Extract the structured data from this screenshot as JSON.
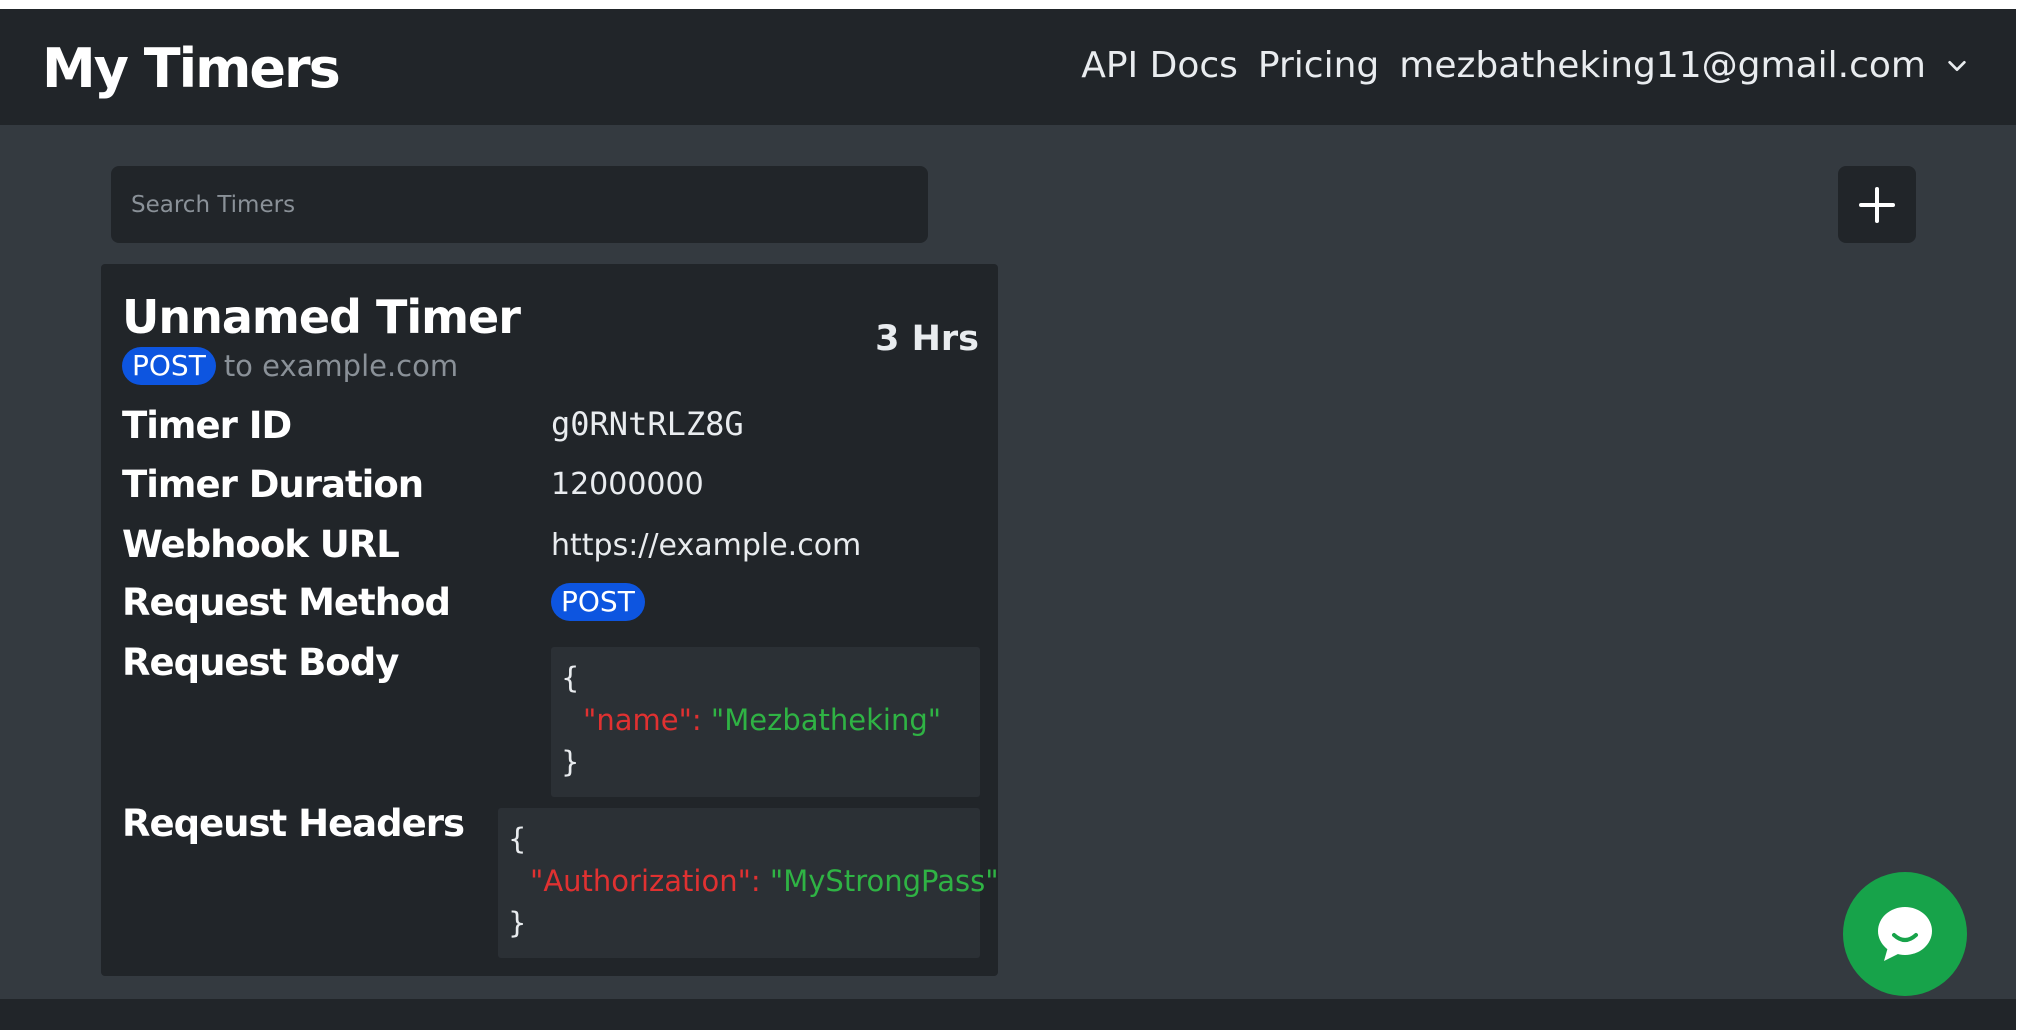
{
  "header": {
    "brand": "My Timers",
    "nav": {
      "api_docs": "API Docs",
      "pricing": "Pricing",
      "user_email": "mezbatheking11@gmail.com"
    }
  },
  "search": {
    "placeholder": "Search Timers",
    "value": ""
  },
  "toolbar": {
    "add_icon": "plus-icon"
  },
  "timer": {
    "title": "Unnamed Timer",
    "method_badge": "POST",
    "target_text": "to example.com",
    "duration_display": "3 Hrs",
    "fields": {
      "timer_id_label": "Timer ID",
      "timer_id_value": "g0RNtRLZ8G",
      "duration_label": "Timer Duration",
      "duration_value": "12000000",
      "webhook_label": "Webhook URL",
      "webhook_value": "https://example.com",
      "method_label": "Request Method",
      "method_value": "POST",
      "body_label": "Request Body",
      "headers_label": "Reqeust Headers"
    },
    "body": {
      "open": "{",
      "key": "\"name\":",
      "value": "\"Mezbatheking\"",
      "close": "}"
    },
    "headers": {
      "open": "{",
      "key": "\"Authorization\":",
      "value": "\"MyStrongPass\"",
      "close": "}"
    }
  },
  "chat": {
    "icon": "chat-bubble-icon"
  },
  "colors": {
    "navbar": "#212529",
    "page_bg": "#343a40",
    "badge": "#0d55e0",
    "json_key": "#e03131",
    "json_value": "#2fb344",
    "chat_button": "#17a34a"
  }
}
